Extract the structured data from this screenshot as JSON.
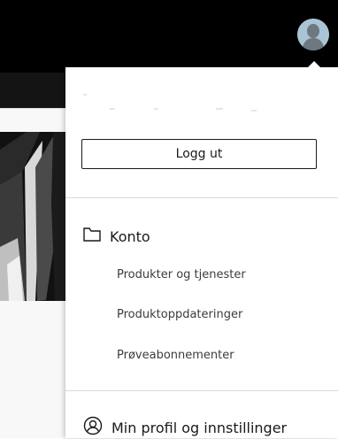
{
  "account_menu": {
    "logout_label": "Logg ut",
    "account_section": {
      "title": "Konto",
      "items": [
        {
          "label": "Produkter og tjenester"
        },
        {
          "label": "Produktoppdateringer"
        },
        {
          "label": "Prøveabonnementer"
        }
      ]
    },
    "profile_label": "Min profil og innstillinger"
  },
  "icons": {
    "account_folder": "folder-icon",
    "profile": "user-circle-icon",
    "avatar": "avatar-icon"
  },
  "colors": {
    "header_bg": "#000000",
    "menu_bg": "#ffffff",
    "avatar": "#a9c4d4"
  }
}
